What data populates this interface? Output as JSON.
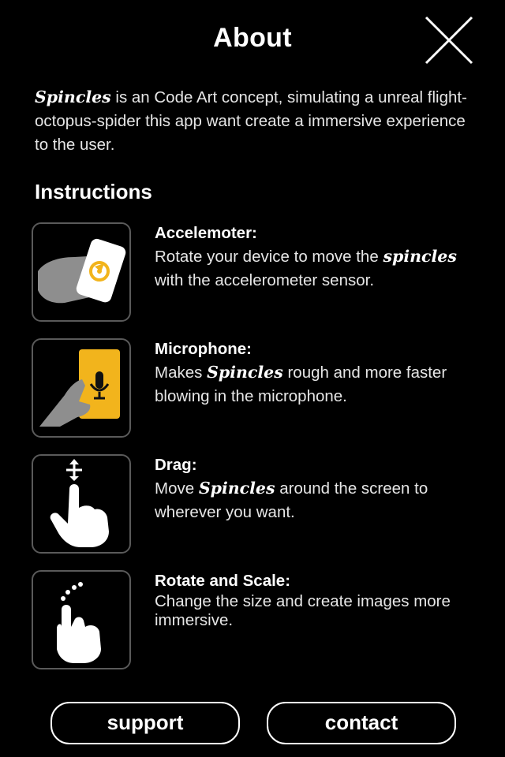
{
  "header": {
    "title": "About",
    "close_icon": "close-icon"
  },
  "intro": {
    "brand": "Spincles",
    "text": " is an Code Art concept, simulating a unreal flight-octopus-spider this app want create a immersive experience to the user."
  },
  "instructions": {
    "heading": "Instructions",
    "items": [
      {
        "title": "Accelemoter:",
        "desc_before": "Rotate your device to move the ",
        "brand": "spincles",
        "desc_after": " with the accelerometer sensor.",
        "icon": "rotate-device-icon"
      },
      {
        "title": "Microphone:",
        "desc_before": "Makes ",
        "brand": "Spincles",
        "desc_after": " rough and more faster blowing in the microphone.",
        "icon": "microphone-icon"
      },
      {
        "title": "Drag:",
        "desc_before": "Move ",
        "brand": "Spincles",
        "desc_after": " around the screen to wherever you want.",
        "icon": "drag-hand-icon"
      },
      {
        "title": "Rotate and Scale:",
        "desc": "Change the size and create images more immersive.",
        "icon": "pinch-hand-icon"
      }
    ]
  },
  "footer": {
    "support_label": "support",
    "contact_label": "contact"
  },
  "colors": {
    "background": "#000000",
    "text": "#ffffff",
    "accent": "#f2b41c",
    "icon_gray": "#9a9a9a"
  }
}
